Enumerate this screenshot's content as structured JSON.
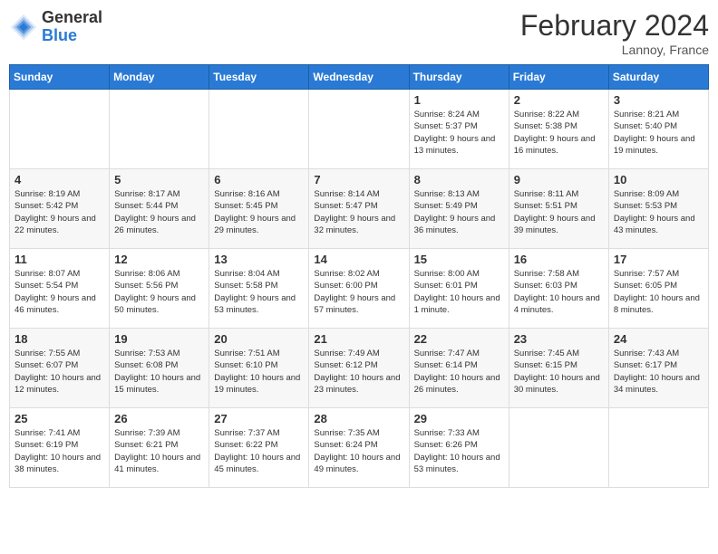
{
  "logo": {
    "general": "General",
    "blue": "Blue"
  },
  "title": "February 2024",
  "subtitle": "Lannoy, France",
  "days_header": [
    "Sunday",
    "Monday",
    "Tuesday",
    "Wednesday",
    "Thursday",
    "Friday",
    "Saturday"
  ],
  "weeks": [
    [
      {
        "day": "",
        "info": ""
      },
      {
        "day": "",
        "info": ""
      },
      {
        "day": "",
        "info": ""
      },
      {
        "day": "",
        "info": ""
      },
      {
        "day": "1",
        "info": "Sunrise: 8:24 AM\nSunset: 5:37 PM\nDaylight: 9 hours\nand 13 minutes."
      },
      {
        "day": "2",
        "info": "Sunrise: 8:22 AM\nSunset: 5:38 PM\nDaylight: 9 hours\nand 16 minutes."
      },
      {
        "day": "3",
        "info": "Sunrise: 8:21 AM\nSunset: 5:40 PM\nDaylight: 9 hours\nand 19 minutes."
      }
    ],
    [
      {
        "day": "4",
        "info": "Sunrise: 8:19 AM\nSunset: 5:42 PM\nDaylight: 9 hours\nand 22 minutes."
      },
      {
        "day": "5",
        "info": "Sunrise: 8:17 AM\nSunset: 5:44 PM\nDaylight: 9 hours\nand 26 minutes."
      },
      {
        "day": "6",
        "info": "Sunrise: 8:16 AM\nSunset: 5:45 PM\nDaylight: 9 hours\nand 29 minutes."
      },
      {
        "day": "7",
        "info": "Sunrise: 8:14 AM\nSunset: 5:47 PM\nDaylight: 9 hours\nand 32 minutes."
      },
      {
        "day": "8",
        "info": "Sunrise: 8:13 AM\nSunset: 5:49 PM\nDaylight: 9 hours\nand 36 minutes."
      },
      {
        "day": "9",
        "info": "Sunrise: 8:11 AM\nSunset: 5:51 PM\nDaylight: 9 hours\nand 39 minutes."
      },
      {
        "day": "10",
        "info": "Sunrise: 8:09 AM\nSunset: 5:53 PM\nDaylight: 9 hours\nand 43 minutes."
      }
    ],
    [
      {
        "day": "11",
        "info": "Sunrise: 8:07 AM\nSunset: 5:54 PM\nDaylight: 9 hours\nand 46 minutes."
      },
      {
        "day": "12",
        "info": "Sunrise: 8:06 AM\nSunset: 5:56 PM\nDaylight: 9 hours\nand 50 minutes."
      },
      {
        "day": "13",
        "info": "Sunrise: 8:04 AM\nSunset: 5:58 PM\nDaylight: 9 hours\nand 53 minutes."
      },
      {
        "day": "14",
        "info": "Sunrise: 8:02 AM\nSunset: 6:00 PM\nDaylight: 9 hours\nand 57 minutes."
      },
      {
        "day": "15",
        "info": "Sunrise: 8:00 AM\nSunset: 6:01 PM\nDaylight: 10 hours\nand 1 minute."
      },
      {
        "day": "16",
        "info": "Sunrise: 7:58 AM\nSunset: 6:03 PM\nDaylight: 10 hours\nand 4 minutes."
      },
      {
        "day": "17",
        "info": "Sunrise: 7:57 AM\nSunset: 6:05 PM\nDaylight: 10 hours\nand 8 minutes."
      }
    ],
    [
      {
        "day": "18",
        "info": "Sunrise: 7:55 AM\nSunset: 6:07 PM\nDaylight: 10 hours\nand 12 minutes."
      },
      {
        "day": "19",
        "info": "Sunrise: 7:53 AM\nSunset: 6:08 PM\nDaylight: 10 hours\nand 15 minutes."
      },
      {
        "day": "20",
        "info": "Sunrise: 7:51 AM\nSunset: 6:10 PM\nDaylight: 10 hours\nand 19 minutes."
      },
      {
        "day": "21",
        "info": "Sunrise: 7:49 AM\nSunset: 6:12 PM\nDaylight: 10 hours\nand 23 minutes."
      },
      {
        "day": "22",
        "info": "Sunrise: 7:47 AM\nSunset: 6:14 PM\nDaylight: 10 hours\nand 26 minutes."
      },
      {
        "day": "23",
        "info": "Sunrise: 7:45 AM\nSunset: 6:15 PM\nDaylight: 10 hours\nand 30 minutes."
      },
      {
        "day": "24",
        "info": "Sunrise: 7:43 AM\nSunset: 6:17 PM\nDaylight: 10 hours\nand 34 minutes."
      }
    ],
    [
      {
        "day": "25",
        "info": "Sunrise: 7:41 AM\nSunset: 6:19 PM\nDaylight: 10 hours\nand 38 minutes."
      },
      {
        "day": "26",
        "info": "Sunrise: 7:39 AM\nSunset: 6:21 PM\nDaylight: 10 hours\nand 41 minutes."
      },
      {
        "day": "27",
        "info": "Sunrise: 7:37 AM\nSunset: 6:22 PM\nDaylight: 10 hours\nand 45 minutes."
      },
      {
        "day": "28",
        "info": "Sunrise: 7:35 AM\nSunset: 6:24 PM\nDaylight: 10 hours\nand 49 minutes."
      },
      {
        "day": "29",
        "info": "Sunrise: 7:33 AM\nSunset: 6:26 PM\nDaylight: 10 hours\nand 53 minutes."
      },
      {
        "day": "",
        "info": ""
      },
      {
        "day": "",
        "info": ""
      }
    ]
  ]
}
